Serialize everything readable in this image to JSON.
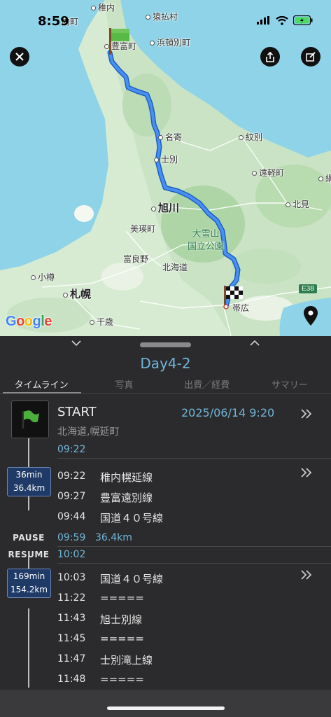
{
  "status": {
    "time": "8:59"
  },
  "map": {
    "logo": "Google",
    "road_badge": "E38",
    "places": {
      "wakkanai": "稚内",
      "sarufutsu": "猿払村",
      "toyotomi": "豊富町",
      "hamatonbetsu": "浜頓別町",
      "nayoro": "名寄",
      "shibetsu": "士別",
      "monbetsu": "紋別",
      "engaru": "遠軽町",
      "asahikawa": "旭川",
      "kitami": "北見",
      "biei": "美瑛町",
      "taisetsu_park": "大雪山\n国立公園",
      "furano": "富良野",
      "hokkaido": "北海道",
      "otaru": "小樽",
      "sapporo": "札幌",
      "obihiro": "帯広",
      "chitose": "千歳",
      "wakkanai_cho": "内町",
      "edge_right": "網"
    }
  },
  "sheet": {
    "title": "Day4-2",
    "tabs": [
      "タイムライン",
      "写真",
      "出費／経費",
      "サマリー"
    ],
    "start": {
      "label": "START",
      "datetime": "2025/06/14 9:20",
      "location": "北海道,幌延町",
      "time": "09:22"
    },
    "segments": [
      {
        "duration": "36min",
        "distance": "36.4km",
        "entries": [
          {
            "time": "09:22",
            "road": "稚内幌延線"
          },
          {
            "time": "09:27",
            "road": "豊富遠別線"
          },
          {
            "time": "09:44",
            "road": "国道４０号線"
          }
        ]
      },
      {
        "duration": "169min",
        "distance": "154.2km",
        "entries": [
          {
            "time": "10:03",
            "road": "国道４０号線"
          },
          {
            "time": "11:22",
            "road": "====="
          },
          {
            "time": "11:43",
            "road": "旭士別線"
          },
          {
            "time": "11:45",
            "road": "====="
          },
          {
            "time": "11:47",
            "road": "士別滝上線"
          },
          {
            "time": "11:48",
            "road": "====="
          }
        ]
      }
    ],
    "pause": {
      "label": "PAUSE",
      "time": "09:59",
      "distance": "36.4km"
    },
    "resume": {
      "label": "RESUME",
      "time": "10:02"
    }
  },
  "colors": {
    "accent": "#6fb6d9",
    "route": "#3d7fe0",
    "badge": "#1f3a66",
    "sheet_bg": "#2b2b2d"
  },
  "icons": [
    "close-icon",
    "share-icon",
    "edit-icon",
    "location-pin-icon",
    "green-flag-icon",
    "checkered-flag-icon",
    "chevron-right-icon",
    "chevron-down-icon",
    "chevron-up-icon"
  ]
}
